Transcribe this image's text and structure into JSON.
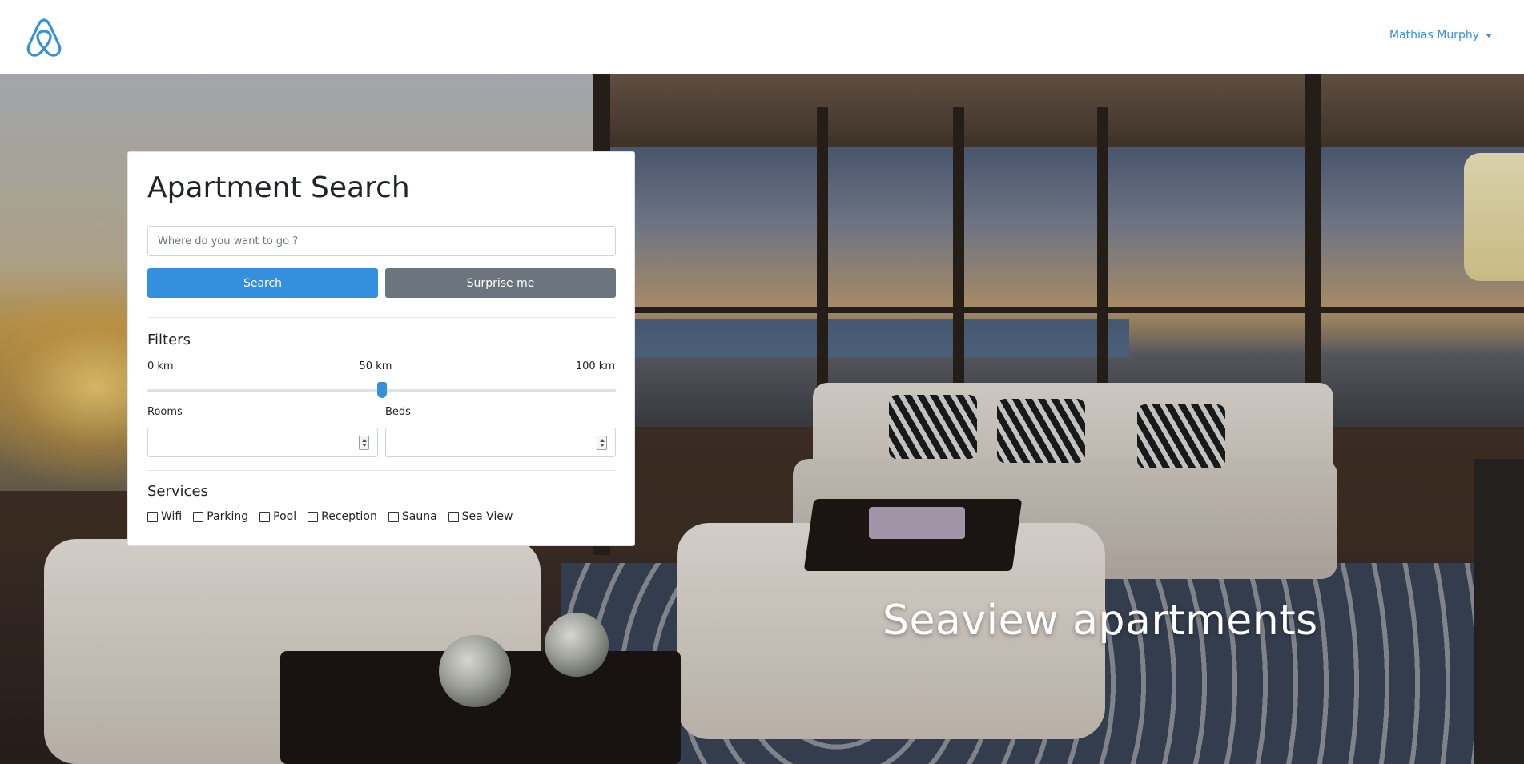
{
  "navbar": {
    "logo_icon": "airbnb-logo-icon",
    "user_name": "Mathias Murphy",
    "accent_color": "#3490dc"
  },
  "hero": {
    "title": "Seaview apartments"
  },
  "search_card": {
    "title": "Apartment Search",
    "search_input": {
      "placeholder": "Where do you want to go ?",
      "value": ""
    },
    "search_button_label": "Search",
    "surprise_button_label": "Surprise me",
    "filters": {
      "title": "Filters",
      "distance": {
        "min_label": "0 km",
        "current_label": "50 km",
        "max_label": "100 km",
        "value_fraction": 0.5
      },
      "rooms_label": "Rooms",
      "rooms_value": "",
      "beds_label": "Beds",
      "beds_value": ""
    },
    "services": {
      "title": "Services",
      "options": [
        {
          "label": "Wifi",
          "checked": false
        },
        {
          "label": "Parking",
          "checked": false
        },
        {
          "label": "Pool",
          "checked": false
        },
        {
          "label": "Reception",
          "checked": false
        },
        {
          "label": "Sauna",
          "checked": false
        },
        {
          "label": "Sea View",
          "checked": false
        }
      ]
    }
  },
  "colors": {
    "primary_button": "#3490dc",
    "secondary_button": "#6c757d"
  }
}
